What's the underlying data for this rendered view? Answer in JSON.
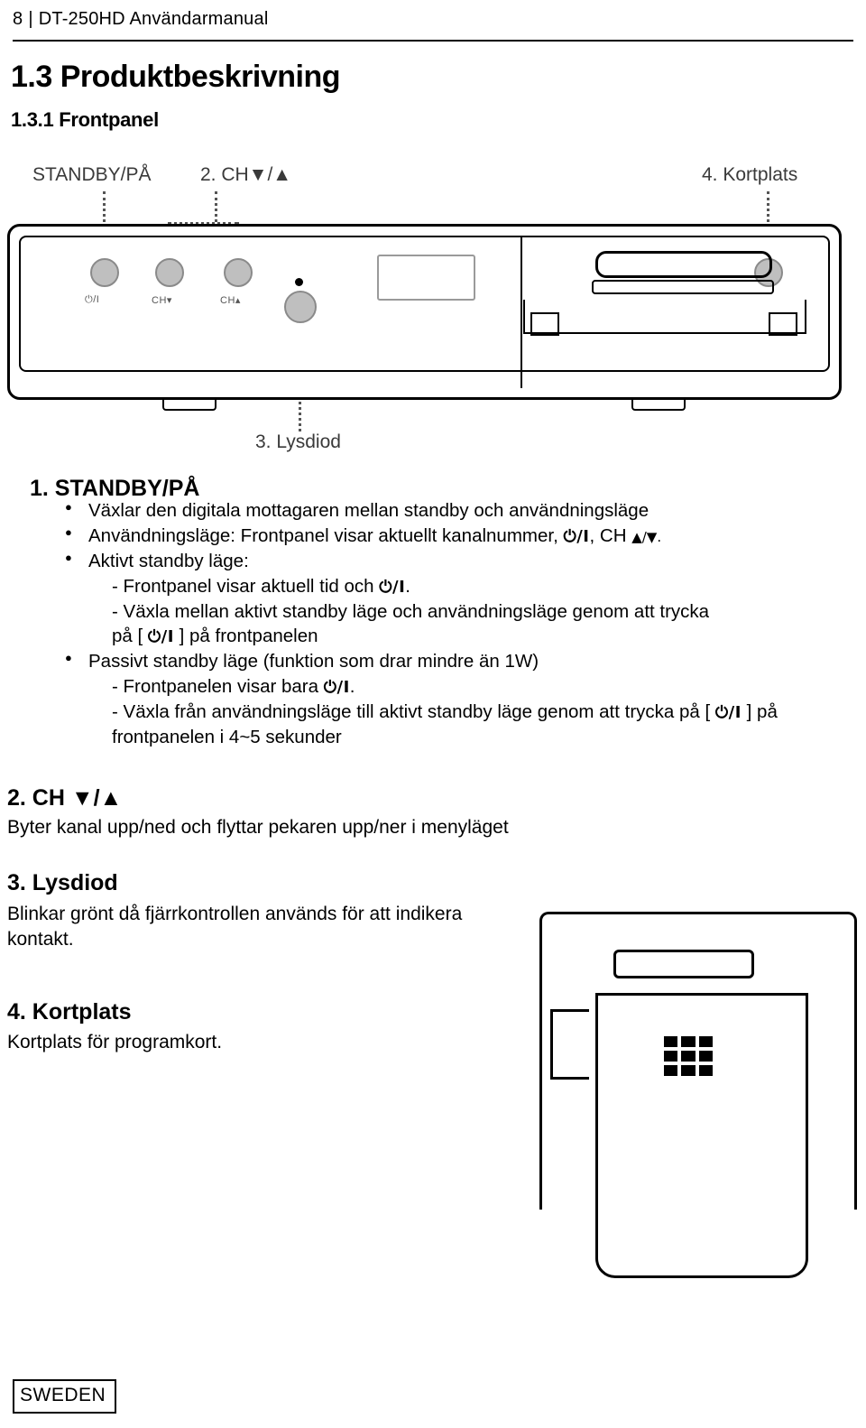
{
  "header": {
    "page_number": "8",
    "separator": "|",
    "manual_title": "DT-250HD Användarmanual"
  },
  "titles": {
    "main": "1.3 Produktbeskrivning",
    "sub": "1.3.1 Frontpanel"
  },
  "diagram": {
    "callout_1": "STANDBY/PÅ",
    "callout_2": "2. CH▼/▲",
    "callout_3": "3. Lysdiod",
    "callout_4": "4. Kortplats",
    "panel_labels": {
      "power": "/I",
      "ch_down": "CH",
      "ch_up": "CH"
    }
  },
  "sections": {
    "s1": {
      "heading": "1. STANDBY/PÅ",
      "b1": "Växlar den digitala mottagaren mellan standby och användningsläge",
      "b2_pre": "Användningsläge: Frontpanel visar aktuellt kanalnummer,",
      "b2_icon": "/I",
      "b2_mid": ", CH",
      "b2_arrows": "▲/▼.",
      "b3": "Aktivt standby läge:",
      "b3_l1_pre": "- Frontpanel visar aktuell tid och",
      "b3_l1_icon": "/I",
      "b3_l1_post": ".",
      "b3_l2_pre": "- Växla mellan aktivt standby läge och användningsläge genom att trycka",
      "b3_l3_pre": "på [",
      "b3_l3_icon": "/I",
      "b3_l3_post": "] på frontpanelen",
      "b4": "Passivt standby läge (funktion som drar mindre än 1W)",
      "b4_l1_pre": "- Frontpanelen visar bara",
      "b4_l1_icon": "/I",
      "b4_l1_post": ".",
      "b4_l2_pre": "- Växla från användningsläge till aktivt standby läge genom att trycka på [",
      "b4_l2_icon": "/I",
      "b4_l2_post": "] på",
      "b4_l3": "frontpanelen i 4~5 sekunder"
    },
    "s2": {
      "heading": "2. CH ▼/▲",
      "body": "Byter kanal upp/ned och flyttar pekaren upp/ner i menyläget"
    },
    "s3": {
      "heading": "3. Lysdiod",
      "body_line1": "Blinkar grönt då fjärrkontrollen används för att indikera",
      "body_line2": "kontakt."
    },
    "s4": {
      "heading": "4. Kortplats",
      "body": "Kortplats för programkort."
    }
  },
  "footer": {
    "label": "SWEDEN"
  }
}
